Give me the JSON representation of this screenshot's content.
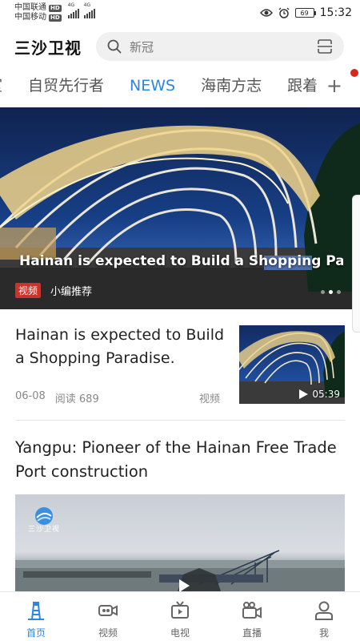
{
  "status_bar": {
    "carrier1": "中国联通",
    "carrier2": "中国移动",
    "hd_badge": "HD",
    "network1": "4G",
    "network2": "4G",
    "battery": "69",
    "time": "15:32",
    "icons": [
      "eye-icon",
      "alarm-icon",
      "battery-icon"
    ]
  },
  "header": {
    "brand": "三沙卫视",
    "search_placeholder": "新冠",
    "icons": [
      "search-icon",
      "scan-icon"
    ]
  },
  "tabs": {
    "items": [
      "室",
      "自贸先行者",
      "NEWS",
      "海南方志",
      "跟着"
    ],
    "active": "NEWS",
    "more_icon": "plus-icon"
  },
  "banner": {
    "title": "Hainan is expected to Build a Shopping Pa...",
    "tag": "视频",
    "subtitle": "小编推荐"
  },
  "article1": {
    "title": " Hainan is expected to Build a Shopping Paradise.",
    "date": "06-08",
    "reads": "阅读 689",
    "type": "视频",
    "duration": "05:39"
  },
  "article2": {
    "title": "Yangpu: Pioneer of the Hainan Free Trade Port construction",
    "logo_text": "三沙卫视"
  },
  "bottom_nav": {
    "items": [
      {
        "label": "首页",
        "icon": "lighthouse-icon"
      },
      {
        "label": "视频",
        "icon": "video-icon"
      },
      {
        "label": "电视",
        "icon": "tv-icon"
      },
      {
        "label": "直播",
        "icon": "live-camera-icon"
      },
      {
        "label": "我",
        "icon": "user-icon"
      }
    ],
    "active": "首页"
  },
  "colors": {
    "accent": "#2f86e0",
    "tag_red": "#c8332b",
    "dot_red": "#d6281c"
  }
}
